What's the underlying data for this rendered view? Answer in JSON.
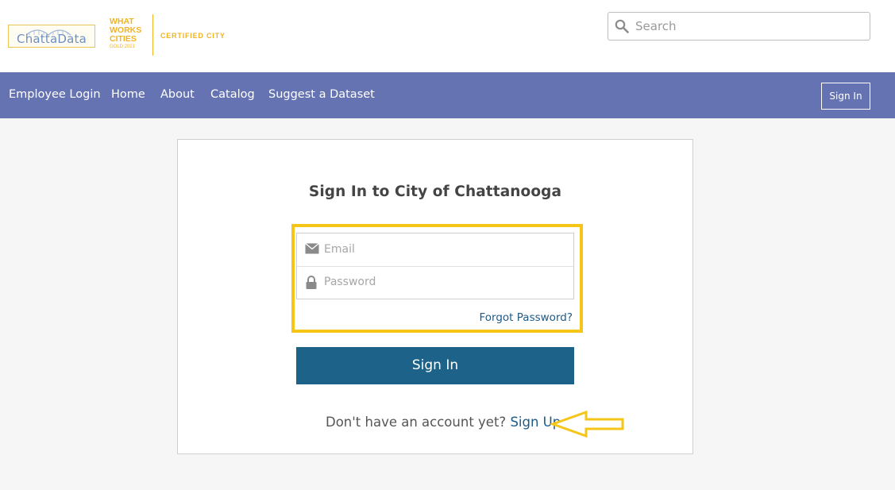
{
  "header": {
    "logo_text": "ChattaData",
    "wwc": {
      "line1": "WHAT",
      "line2": "WORKS",
      "line3": "CITIES",
      "gold": "GOLD 2021",
      "certified": "CERTIFIED CITY"
    },
    "search": {
      "placeholder": "Search",
      "icon": "search-icon"
    }
  },
  "nav": {
    "items": [
      {
        "label": "Employee Login"
      },
      {
        "label": "Home"
      },
      {
        "label": "About"
      },
      {
        "label": "Catalog"
      },
      {
        "label": "Suggest a Dataset"
      }
    ],
    "signin_label": "Sign In"
  },
  "login": {
    "title": "Sign In to City of Chattanooga",
    "email_placeholder": "Email",
    "password_placeholder": "Password",
    "forgot_label": "Forgot Password?",
    "signin_button": "Sign In",
    "no_account_text": "Don't have an account yet?",
    "signup_label": "Sign Up"
  },
  "colors": {
    "nav_bg": "#6673b2",
    "button_bg": "#1d6389",
    "link": "#1e5a86",
    "highlight": "#f5c518",
    "brand_gold": "#f0b323"
  }
}
